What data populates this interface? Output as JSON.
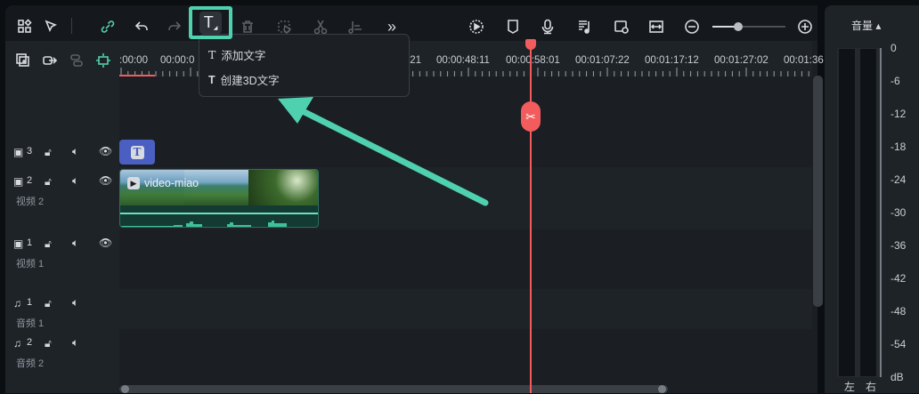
{
  "toolbar": {
    "icons": [
      "layout-icon",
      "select-tool-icon",
      "link-icon",
      "undo-icon",
      "redo-icon",
      "text-icon",
      "delete-icon",
      "crop-icon",
      "cut-icon",
      "audio-align-icon",
      "more-icon",
      "render-preview-icon",
      "marker-icon",
      "microphone-icon",
      "music-list-icon",
      "snapshot-icon",
      "fit-icon",
      "zoom-out-icon",
      "zoom-in-icon"
    ],
    "zoom_level": 0.4
  },
  "text_menu": {
    "items": [
      {
        "icon": "text-icon",
        "label": "添加文字"
      },
      {
        "icon": "3d-text-icon",
        "label": "创建3D文字"
      }
    ]
  },
  "ruler": {
    "labels": [
      ":00:00",
      "00:00:0",
      ":21",
      "00:00:48:11",
      "00:00:58:01",
      "00:01:07:22",
      "00:01:17:12",
      "00:01:27:02",
      "00:01:36"
    ]
  },
  "tracks": [
    {
      "type": "video",
      "number": "3",
      "name": ""
    },
    {
      "type": "video",
      "number": "2",
      "name": "视频 2"
    },
    {
      "type": "video",
      "number": "1",
      "name": "视频 1"
    },
    {
      "type": "audio",
      "number": "1",
      "name": "音频 1"
    },
    {
      "type": "audio",
      "number": "2",
      "name": "音频 2"
    }
  ],
  "clips": {
    "title_clip": "T",
    "video_clip": "video-miao"
  },
  "volume": {
    "title": "音量 ▴",
    "scale": [
      "0",
      "-6",
      "-12",
      "-18",
      "-24",
      "-30",
      "-36",
      "-42",
      "-48",
      "-54",
      "dB"
    ],
    "left": "左",
    "right": "右"
  },
  "colors": {
    "accent": "#4fd1b0",
    "playhead": "#f25c5c",
    "title_clip": "#4a5fc1"
  }
}
